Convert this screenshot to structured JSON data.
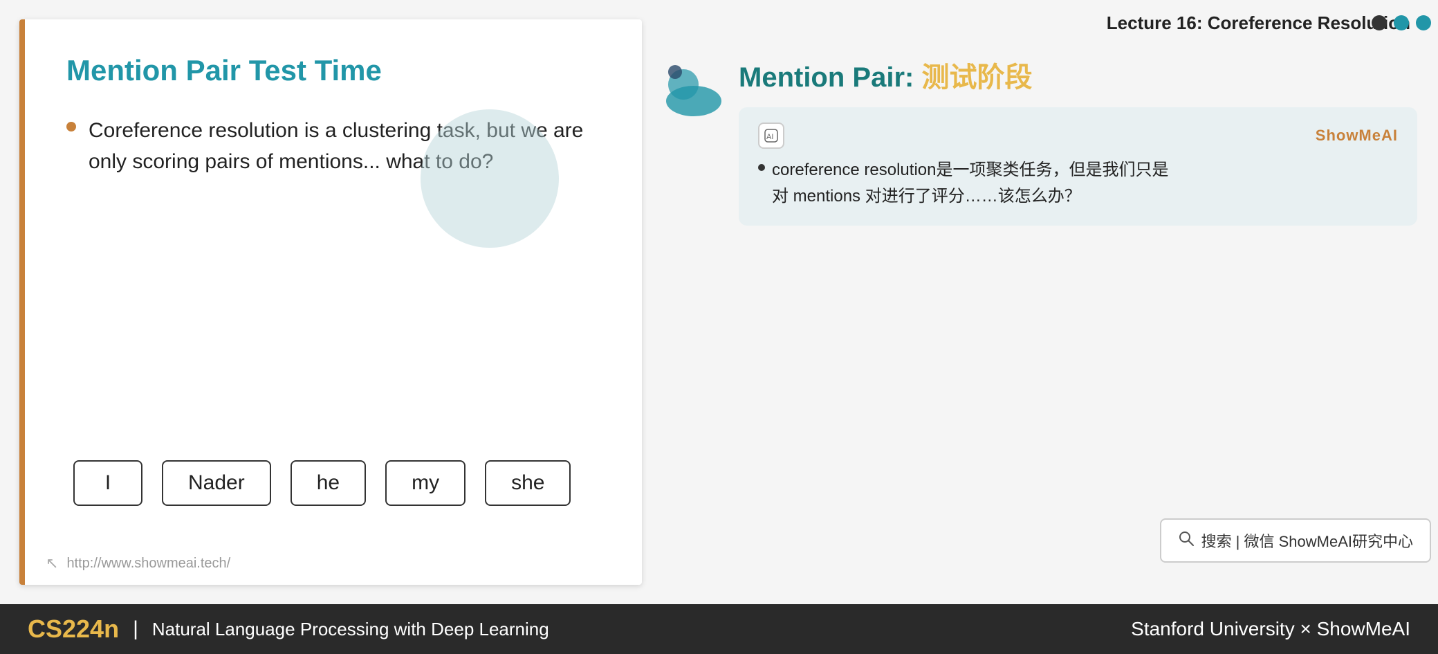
{
  "header": {
    "lecture_title": "Lecture 16: Coreference Resolution"
  },
  "slide": {
    "title": "Mention Pair Test Time",
    "bullet": "Coreference resolution is a clustering task, but we are only scoring pairs of mentions... what to do?",
    "footer_url": "http://www.showmeai.tech/",
    "tokens": [
      "I",
      "Nader",
      "he",
      "my",
      "she"
    ]
  },
  "right_panel": {
    "mention_pair_title_part1": "Mention Pair: ",
    "mention_pair_title_part2": "测试阶段",
    "dots": [
      "dark",
      "teal",
      "teal"
    ],
    "translation_box": {
      "showmeai_label": "ShowMeAI",
      "text_line1": "coreference resolution是一项聚类任务，但是我们只是",
      "text_line2": "对 mentions 对进行了评分……该怎么办？"
    }
  },
  "search_bar": {
    "text": "搜索 | 微信 ShowMeAI研究中心"
  },
  "footer": {
    "cs224n": "CS224n",
    "pipe": "|",
    "subtitle": "Natural Language Processing with Deep Learning",
    "right": "Stanford University × ShowMeAI"
  }
}
